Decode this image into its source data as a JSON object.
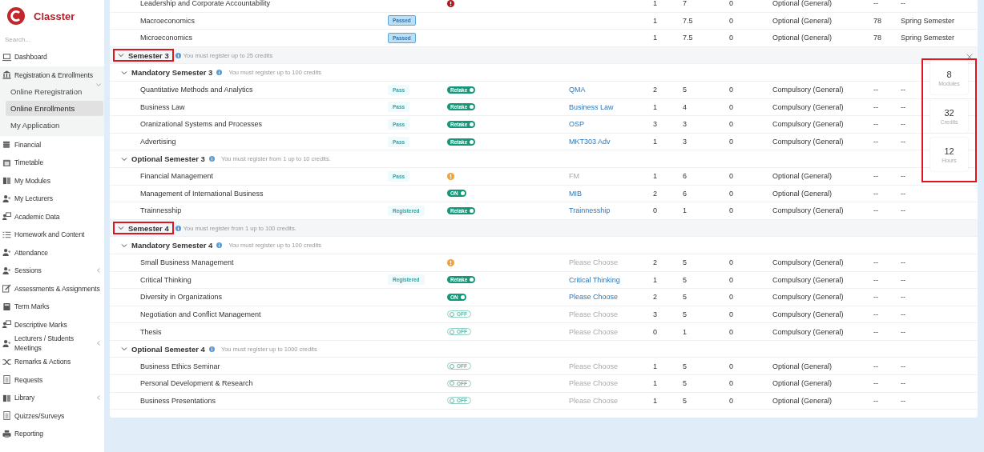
{
  "sidebar": {
    "logo": "Classter",
    "search": {
      "placeholder": "Search..."
    },
    "items": [
      {
        "label": "Dashboard",
        "selected": false
      },
      {
        "label": "Registration & Enrollments",
        "selected": false,
        "expanded": true,
        "children": [
          {
            "label": "Online Reregistration",
            "selected": false
          },
          {
            "label": "Online Enrollments",
            "selected": true
          },
          {
            "label": "My Application",
            "selected": false
          }
        ]
      },
      {
        "label": "Financial",
        "selected": false
      },
      {
        "label": "Timetable",
        "selected": false
      },
      {
        "label": "My Modules",
        "selected": false
      },
      {
        "label": "My Lecturers",
        "selected": false
      },
      {
        "label": "Academic Data",
        "selected": false
      },
      {
        "label": "Homework and Content",
        "selected": false
      },
      {
        "label": "Attendance",
        "selected": false
      },
      {
        "label": "Sessions",
        "selected": false,
        "expanded": false
      },
      {
        "label": "Assessments & Assignments",
        "selected": false
      },
      {
        "label": "Term Marks",
        "selected": false
      },
      {
        "label": "Descriptive Marks",
        "selected": false
      },
      {
        "label": "Lecturers / Students Meetings",
        "selected": false,
        "expanded": false
      },
      {
        "label": "Remarks & Actions",
        "selected": false
      },
      {
        "label": "Requests",
        "selected": false
      },
      {
        "label": "Library",
        "selected": false,
        "expanded": false
      },
      {
        "label": "Quizzes/Surveys",
        "selected": false
      },
      {
        "label": "Reporting",
        "selected": false
      }
    ]
  },
  "rows": [
    {
      "kind": "module",
      "name": "Leadership and Corporate Accountability",
      "status": {
        "kind": "alert"
      },
      "cells": [
        "1",
        "7",
        "0",
        "Optional (General)",
        "--",
        "--"
      ]
    },
    {
      "kind": "module",
      "name": "Macroeconomics",
      "badge": {
        "label": "Passed",
        "kind": "solid"
      },
      "cells": [
        "1",
        "7.5",
        "0",
        "Optional (General)",
        "78",
        "Spring Semester"
      ]
    },
    {
      "kind": "module",
      "name": "Microeconomics",
      "badge": {
        "label": "Passed",
        "kind": "solid"
      },
      "cells": [
        "1",
        "7.5",
        "0",
        "Optional (General)",
        "78",
        "Spring Semester"
      ]
    },
    {
      "kind": "semester",
      "title": "Semester 3",
      "note": "You must register up to 25 credits",
      "expanded": true,
      "highlighted": true
    },
    {
      "kind": "group",
      "title": "Mandatory Semester 3",
      "note": "You must register up to 100 credits",
      "expanded": true
    },
    {
      "kind": "module",
      "name": "Quantitative Methods and Analytics",
      "badge": {
        "label": "Pass",
        "kind": "light"
      },
      "status": {
        "kind": "toggle",
        "label": "Retake",
        "on": true
      },
      "code": {
        "text": "QMA",
        "muted": false
      },
      "cells": [
        "2",
        "5",
        "0",
        "Compulsory (General)",
        "--",
        "--"
      ]
    },
    {
      "kind": "module",
      "name": "Business Law",
      "badge": {
        "label": "Pass",
        "kind": "light"
      },
      "status": {
        "kind": "toggle",
        "label": "Retake",
        "on": true
      },
      "code": {
        "text": "Business Law",
        "muted": false
      },
      "cells": [
        "1",
        "4",
        "0",
        "Compulsory (General)",
        "--",
        "--"
      ]
    },
    {
      "kind": "module",
      "name": "Oranizational Systems and Processes",
      "badge": {
        "label": "Pass",
        "kind": "light"
      },
      "status": {
        "kind": "toggle",
        "label": "Retake",
        "on": true
      },
      "code": {
        "text": "OSP",
        "muted": false
      },
      "cells": [
        "3",
        "3",
        "0",
        "Compulsory (General)",
        "--",
        "--"
      ]
    },
    {
      "kind": "module",
      "name": "Advertising",
      "badge": {
        "label": "Pass",
        "kind": "light"
      },
      "status": {
        "kind": "toggle",
        "label": "Retake",
        "on": true
      },
      "code": {
        "text": "MKT303 Adv",
        "muted": false
      },
      "cells": [
        "1",
        "3",
        "0",
        "Compulsory (General)",
        "--",
        "--"
      ]
    },
    {
      "kind": "group",
      "title": "Optional Semester 3",
      "note": "You must register from 1 up to 10 credits.",
      "expanded": true
    },
    {
      "kind": "module",
      "name": "Financial Management",
      "badge": {
        "label": "Pass",
        "kind": "light"
      },
      "status": {
        "kind": "warning"
      },
      "code": {
        "text": "FM",
        "muted": true
      },
      "cells": [
        "1",
        "6",
        "0",
        "Optional (General)",
        "--",
        "--"
      ]
    },
    {
      "kind": "module",
      "name": "Management of International Business",
      "status": {
        "kind": "toggle",
        "label": "ON",
        "on": true
      },
      "code": {
        "text": "MIB",
        "muted": false
      },
      "cells": [
        "2",
        "6",
        "0",
        "Optional (General)",
        "--",
        "--"
      ]
    },
    {
      "kind": "module",
      "name": "Trainnesship",
      "badge": {
        "label": "Registered",
        "kind": "light"
      },
      "status": {
        "kind": "toggle",
        "label": "Retake",
        "on": true
      },
      "code": {
        "text": "Trainnesship",
        "muted": false
      },
      "cells": [
        "0",
        "1",
        "0",
        "Compulsory (General)",
        "--",
        "--"
      ]
    },
    {
      "kind": "semester",
      "title": "Semester 4",
      "note": "You must register from 1 up to 100 credits.",
      "expanded": true,
      "highlighted": true
    },
    {
      "kind": "group",
      "title": "Mandatory Semester 4",
      "note": "You must register up to 100 credits",
      "expanded": true
    },
    {
      "kind": "module",
      "name": "Small Business Management",
      "status": {
        "kind": "warning"
      },
      "code": {
        "text": "Please Choose",
        "muted": true
      },
      "cells": [
        "2",
        "5",
        "0",
        "Compulsory (General)",
        "--",
        "--"
      ]
    },
    {
      "kind": "module",
      "name": "Critical Thinking",
      "badge": {
        "label": "Registered",
        "kind": "light"
      },
      "status": {
        "kind": "toggle",
        "label": "Retake",
        "on": true
      },
      "code": {
        "text": "Critical Thinking",
        "muted": false
      },
      "cells": [
        "1",
        "5",
        "0",
        "Compulsory (General)",
        "--",
        "--"
      ]
    },
    {
      "kind": "module",
      "name": "Diversity in Organizations",
      "status": {
        "kind": "toggle",
        "label": "ON",
        "on": true
      },
      "code": {
        "text": "Please Choose",
        "muted": false
      },
      "cells": [
        "2",
        "5",
        "0",
        "Compulsory (General)",
        "--",
        "--"
      ]
    },
    {
      "kind": "module",
      "name": "Negotiation and Conflict Management",
      "status": {
        "kind": "toggle",
        "label": "OFF",
        "on": false
      },
      "code": {
        "text": "Please Choose",
        "muted": true
      },
      "cells": [
        "3",
        "5",
        "0",
        "Compulsory (General)",
        "--",
        "--"
      ]
    },
    {
      "kind": "module",
      "name": "Thesis",
      "status": {
        "kind": "toggle",
        "label": "OFF",
        "on": false
      },
      "code": {
        "text": "Please Choose",
        "muted": true
      },
      "cells": [
        "0",
        "1",
        "0",
        "Compulsory (General)",
        "--",
        "--"
      ]
    },
    {
      "kind": "group",
      "title": "Optional Semester 4",
      "note": "You must register up to 1000 credits",
      "expanded": true
    },
    {
      "kind": "module",
      "name": "Business Ethics Seminar",
      "status": {
        "kind": "toggle",
        "label": "OFF",
        "on": false
      },
      "code": {
        "text": "Please Choose",
        "muted": true
      },
      "cells": [
        "1",
        "5",
        "0",
        "Optional (General)",
        "--",
        "--"
      ]
    },
    {
      "kind": "module",
      "name": "Personal Development & Research",
      "status": {
        "kind": "toggle",
        "label": "OFF",
        "on": false
      },
      "code": {
        "text": "Please Choose",
        "muted": true
      },
      "cells": [
        "1",
        "5",
        "0",
        "Optional (General)",
        "--",
        "--"
      ]
    },
    {
      "kind": "module",
      "name": "Business Presentations",
      "status": {
        "kind": "toggle",
        "label": "OFF",
        "on": false
      },
      "code": {
        "text": "Please Choose",
        "muted": true
      },
      "cells": [
        "1",
        "5",
        "0",
        "Optional (General)",
        "--",
        "--"
      ]
    }
  ],
  "stats": {
    "highlighted": true,
    "items": [
      {
        "value": "8",
        "label": "Modules"
      },
      {
        "value": "32",
        "label": "Credits"
      },
      {
        "value": "12",
        "label": "Hours"
      }
    ]
  }
}
